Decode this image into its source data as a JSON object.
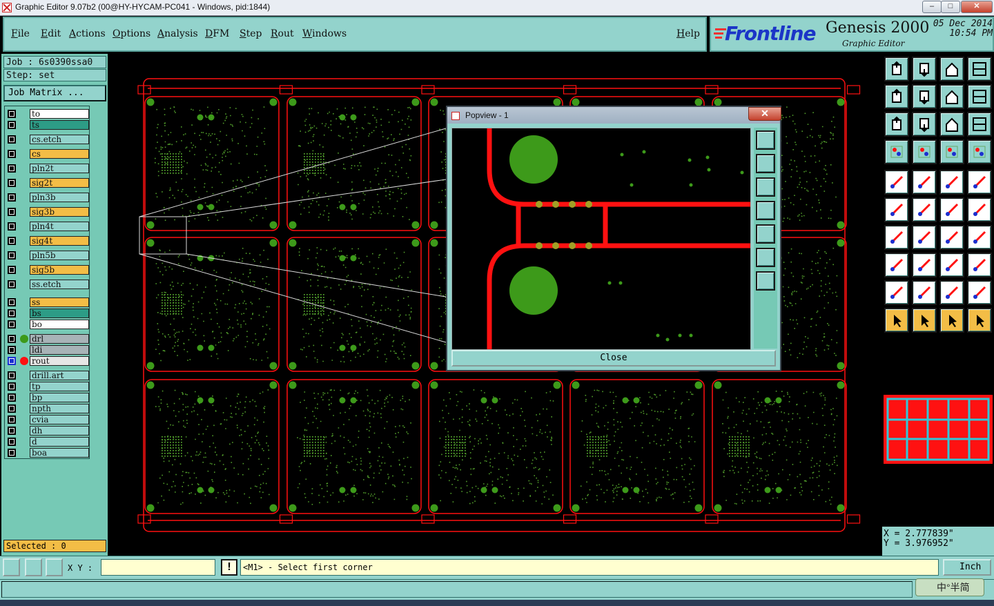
{
  "window": {
    "title": "Graphic Editor 9.07b2 (00@HY-HYCAM-PC041 - Windows, pid:1844)",
    "min": "–",
    "max": "□",
    "close": "✕"
  },
  "menu": {
    "items": [
      "File",
      "Edit",
      "Actions",
      "Options",
      "Analysis",
      "DFM",
      "Step",
      "Rout",
      "Windows"
    ],
    "help": "Help"
  },
  "brand": {
    "logo": "Frontline",
    "product": "Genesis 2000",
    "subtitle": "Graphic Editor",
    "date": "05 Dec 2014",
    "time": "10:54 PM"
  },
  "job": {
    "job_text": "Job : 6s0390ssa0",
    "step_text": "Step: set",
    "matrix_button": "Job Matrix ..."
  },
  "layers": [
    {
      "name": "to",
      "color": "#ffffff",
      "group": 0
    },
    {
      "name": "ts",
      "color": "#2d9c86",
      "group": 0
    },
    {
      "name": "cs.etch",
      "color": "#93d3cc",
      "group": 1
    },
    {
      "name": "cs",
      "color": "#f3bd46",
      "group": 1
    },
    {
      "name": "pln2t",
      "color": "#93d3cc",
      "group": 1
    },
    {
      "name": "sig2t",
      "color": "#f3bd46",
      "group": 1
    },
    {
      "name": "pln3b",
      "color": "#93d3cc",
      "group": 1
    },
    {
      "name": "sig3b",
      "color": "#f3bd46",
      "group": 1
    },
    {
      "name": "pln4t",
      "color": "#93d3cc",
      "group": 1
    },
    {
      "name": "sig4t",
      "color": "#f3bd46",
      "group": 1
    },
    {
      "name": "pln5b",
      "color": "#93d3cc",
      "group": 1
    },
    {
      "name": "sig5b",
      "color": "#f3bd46",
      "group": 1
    },
    {
      "name": "ss.etch",
      "color": "#93d3cc",
      "group": 1
    },
    {
      "name": "ss",
      "color": "#f3bd46",
      "group": 2
    },
    {
      "name": "bs",
      "color": "#2d9c86",
      "group": 2
    },
    {
      "name": "bo",
      "color": "#ffffff",
      "group": 2
    },
    {
      "name": "drl",
      "color": "#a8b3b7",
      "group": 3,
      "dot": "#3d9a1a"
    },
    {
      "name": "ldi",
      "color": "#a8b3b7",
      "group": 3
    },
    {
      "name": "rout",
      "color": "#e6e6e6",
      "group": 3,
      "dot": "#ff1111",
      "active": true
    },
    {
      "name": "drill.art",
      "color": "#93d3cc",
      "group": 4
    },
    {
      "name": "tp",
      "color": "#93d3cc",
      "group": 4
    },
    {
      "name": "bp",
      "color": "#93d3cc",
      "group": 4
    },
    {
      "name": "npth",
      "color": "#93d3cc",
      "group": 4
    },
    {
      "name": "cvia",
      "color": "#93d3cc",
      "group": 4
    },
    {
      "name": "dh",
      "color": "#93d3cc",
      "group": 4
    },
    {
      "name": "d",
      "color": "#93d3cc",
      "group": 4
    },
    {
      "name": "boa",
      "color": "#93d3cc",
      "group": 4
    }
  ],
  "selected": "Selected : 0",
  "popview": {
    "title": "Popview - 1",
    "close_label": "Close",
    "close_x": "✕"
  },
  "coords": {
    "x": "X = 2.777839\"",
    "y": "Y = 3.976952\""
  },
  "status": {
    "xy_label": "X Y :",
    "xy_value": "",
    "warn": "!",
    "prompt": "<M1> - Select first corner",
    "unit": "Inch"
  },
  "ime": {
    "label": "中°半简"
  },
  "colors": {
    "panel": "#93d3cc",
    "trace": "#ff1111",
    "pad": "#3d9a1a",
    "accent": "#f3bd46"
  }
}
